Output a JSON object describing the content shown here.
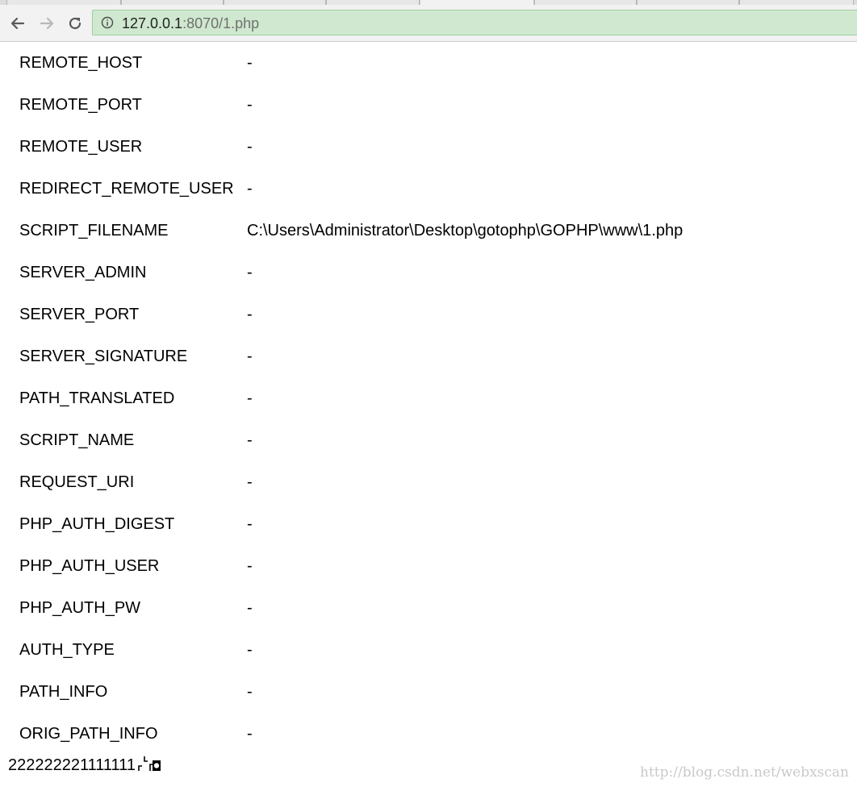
{
  "browser": {
    "url_host": "127.0.0.1",
    "url_rest": ":8070/1.php"
  },
  "table": [
    {
      "key": "REMOTE_HOST",
      "value": "-"
    },
    {
      "key": "REMOTE_PORT",
      "value": "-"
    },
    {
      "key": "REMOTE_USER",
      "value": "-"
    },
    {
      "key": "REDIRECT_REMOTE_USER",
      "value": "-"
    },
    {
      "key": "SCRIPT_FILENAME",
      "value": "C:\\Users\\Administrator\\Desktop\\gotophp\\GOPHP\\www\\1.php"
    },
    {
      "key": "SERVER_ADMIN",
      "value": "-"
    },
    {
      "key": "SERVER_PORT",
      "value": "-"
    },
    {
      "key": "SERVER_SIGNATURE",
      "value": "-"
    },
    {
      "key": "PATH_TRANSLATED",
      "value": "-"
    },
    {
      "key": "SCRIPT_NAME",
      "value": "-"
    },
    {
      "key": "REQUEST_URI",
      "value": "-"
    },
    {
      "key": "PHP_AUTH_DIGEST",
      "value": "-"
    },
    {
      "key": "PHP_AUTH_USER",
      "value": "-"
    },
    {
      "key": "PHP_AUTH_PW",
      "value": "-"
    },
    {
      "key": "AUTH_TYPE",
      "value": "-"
    },
    {
      "key": "PATH_INFO",
      "value": "-"
    },
    {
      "key": "ORIG_PATH_INFO",
      "value": "-"
    }
  ],
  "output_text": "222222221111111",
  "watermark": "http://blog.csdn.net/webxscan",
  "icons": {
    "back": "arrow-left-icon",
    "forward": "arrow-right-icon",
    "reload": "reload-icon",
    "info": "info-circle-icon"
  }
}
